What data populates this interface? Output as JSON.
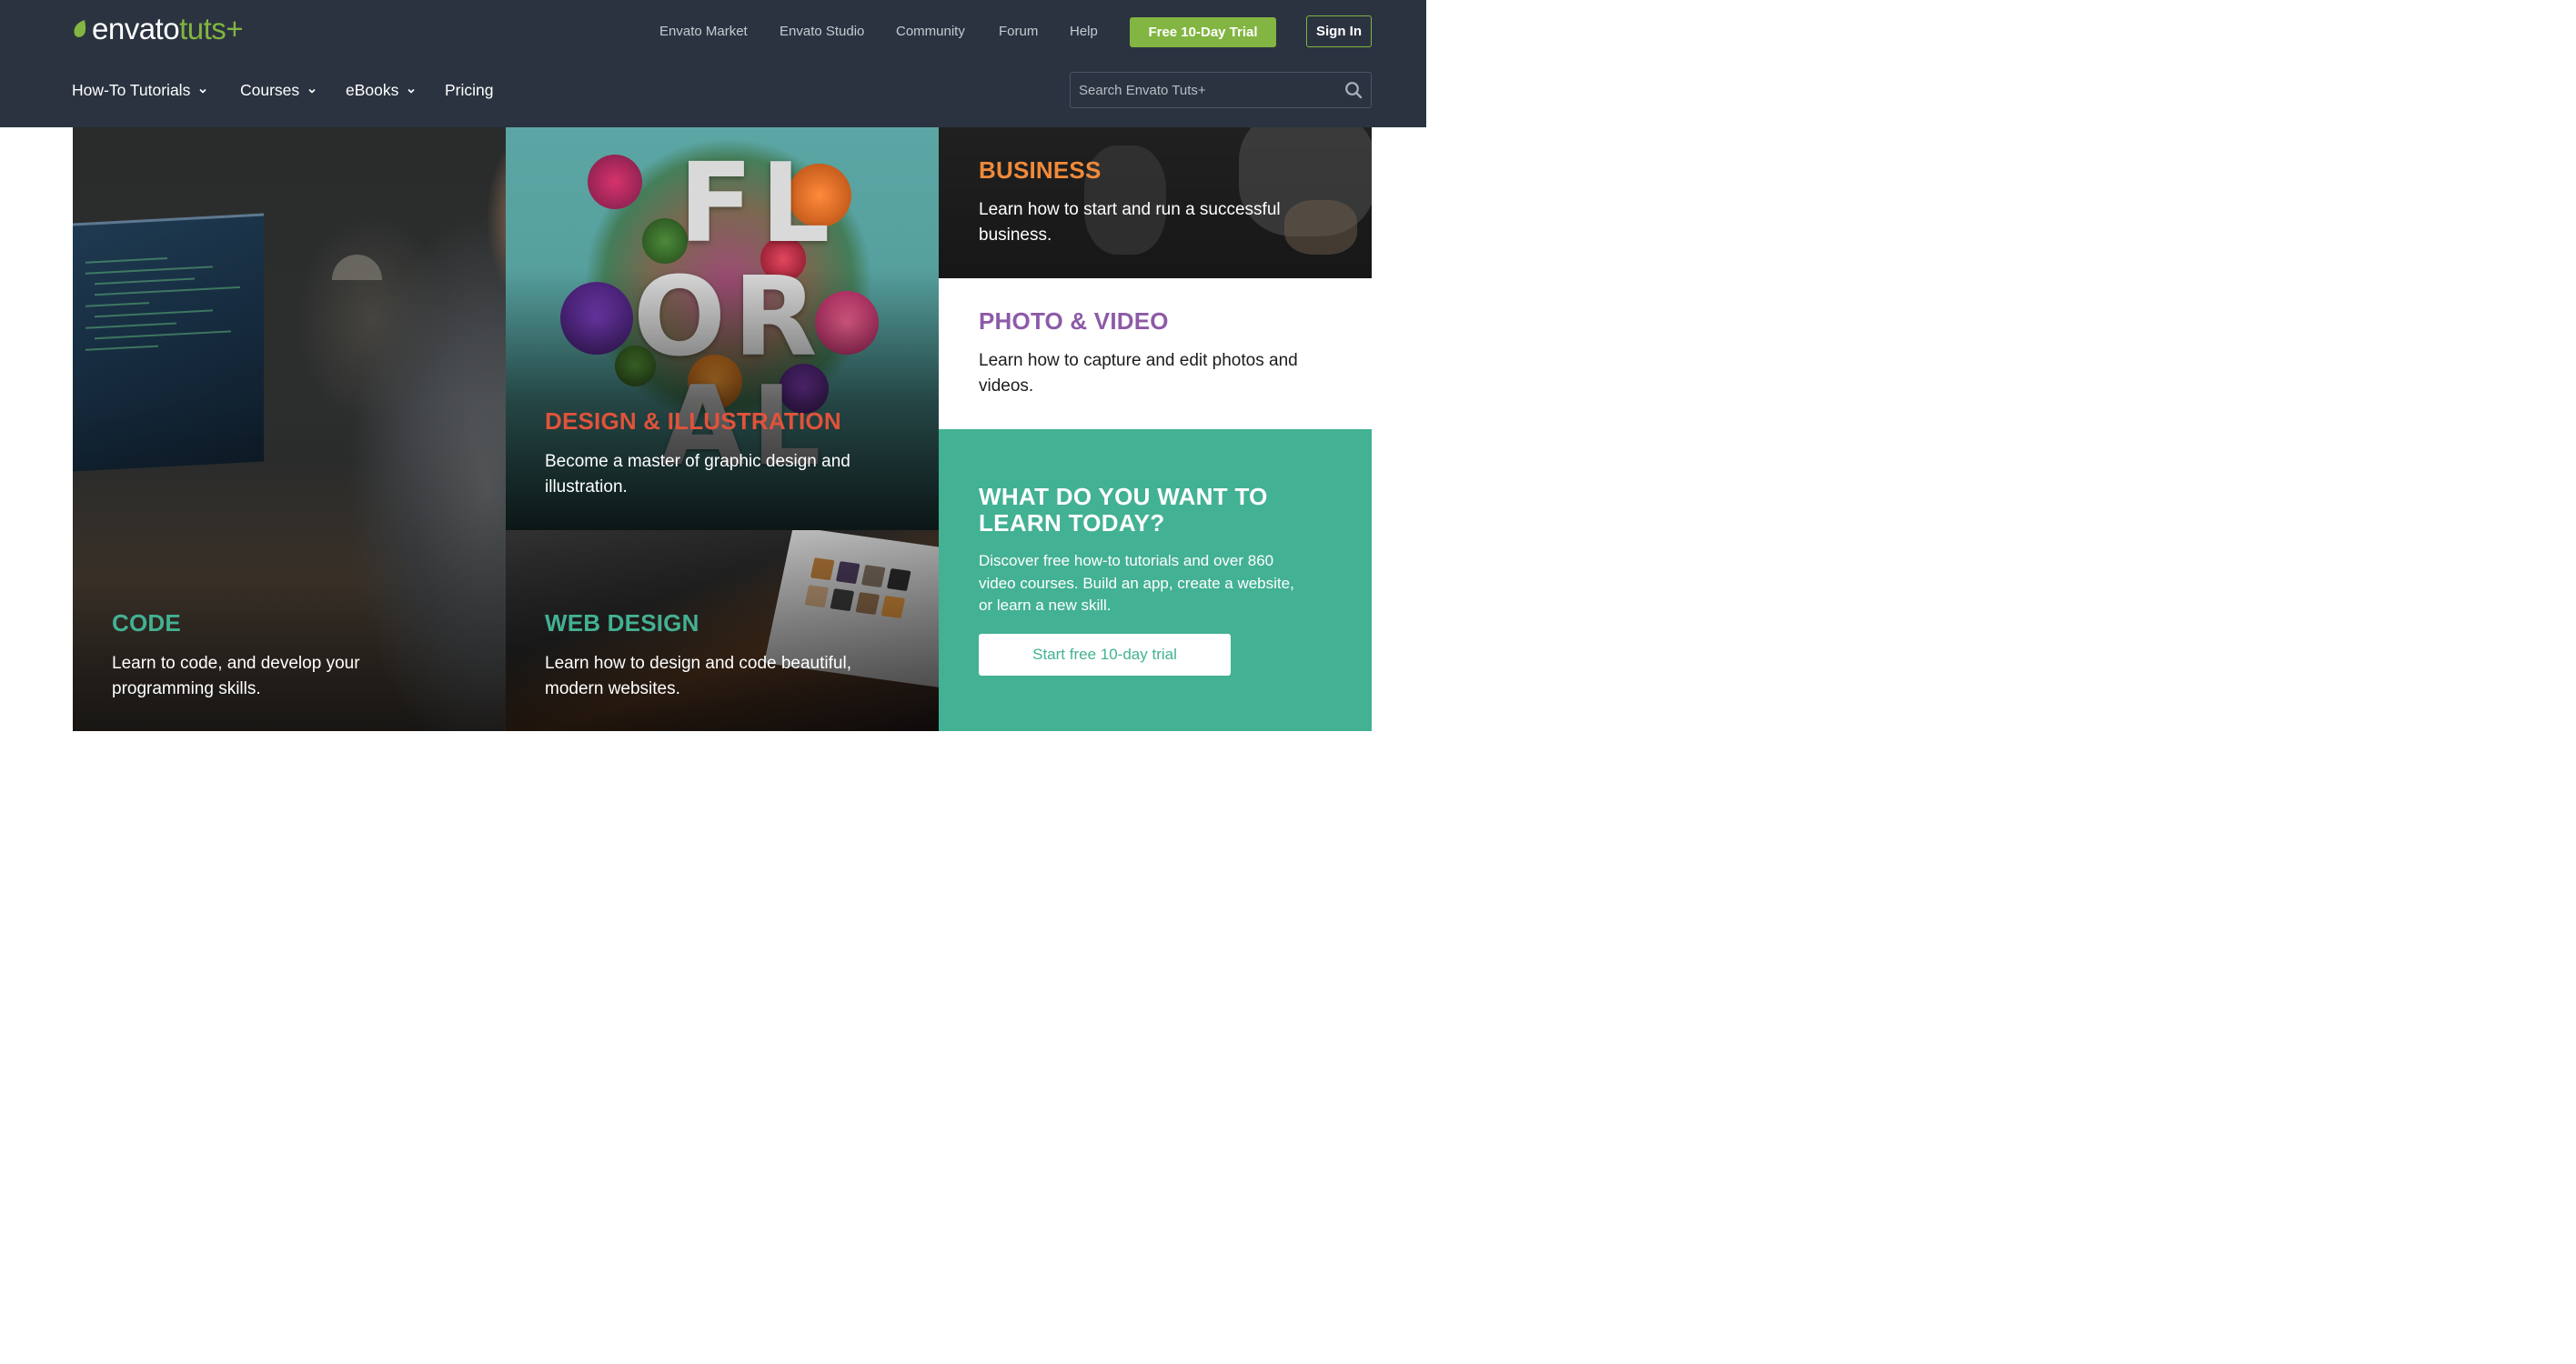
{
  "header": {
    "logo": {
      "word_envato": "envato",
      "word_tuts": "tuts+"
    },
    "top_links": [
      {
        "label": "Envato Market"
      },
      {
        "label": "Envato Studio"
      },
      {
        "label": "Community"
      },
      {
        "label": "Forum"
      },
      {
        "label": "Help"
      }
    ],
    "trial_button": "Free 10-Day Trial",
    "signin_button": "Sign In",
    "nav": [
      {
        "label": "How-To Tutorials",
        "dropdown": true
      },
      {
        "label": "Courses",
        "dropdown": true
      },
      {
        "label": "eBooks",
        "dropdown": true
      },
      {
        "label": "Pricing",
        "dropdown": false
      }
    ],
    "search": {
      "placeholder": "Search Envato Tuts+",
      "value": "",
      "icon": "search-icon"
    }
  },
  "tiles": {
    "code": {
      "title": "CODE",
      "desc": "Learn to code, and develop your programming skills.",
      "color": "#43b193"
    },
    "design": {
      "title": "DESIGN & ILLUSTRATION",
      "desc": "Become a master of graphic design and illustration.",
      "color": "#e0533b",
      "image_text": [
        "F",
        "L",
        "O",
        "R",
        "A",
        "L"
      ]
    },
    "web": {
      "title": "WEB DESIGN",
      "desc": "Learn how to design and code beautiful, modern websites.",
      "color": "#43b193"
    },
    "business": {
      "title": "BUSINESS",
      "desc": "Learn how to start and run a successful business.",
      "color": "#f08a3a"
    },
    "photo": {
      "title": "PHOTO & VIDEO",
      "desc": "Learn how to capture and edit photos and videos.",
      "color": "#8d5aa8"
    }
  },
  "cta": {
    "title": "WHAT DO YOU WANT TO LEARN TODAY?",
    "desc": "Discover free how-to tutorials and over 860 video courses. Build an app, create a website, or learn a new skill.",
    "button": "Start free 10-day trial",
    "background": "#43b193"
  },
  "colors": {
    "header_bg": "#2b3340",
    "accent_green": "#82b541",
    "teal": "#43b193"
  }
}
